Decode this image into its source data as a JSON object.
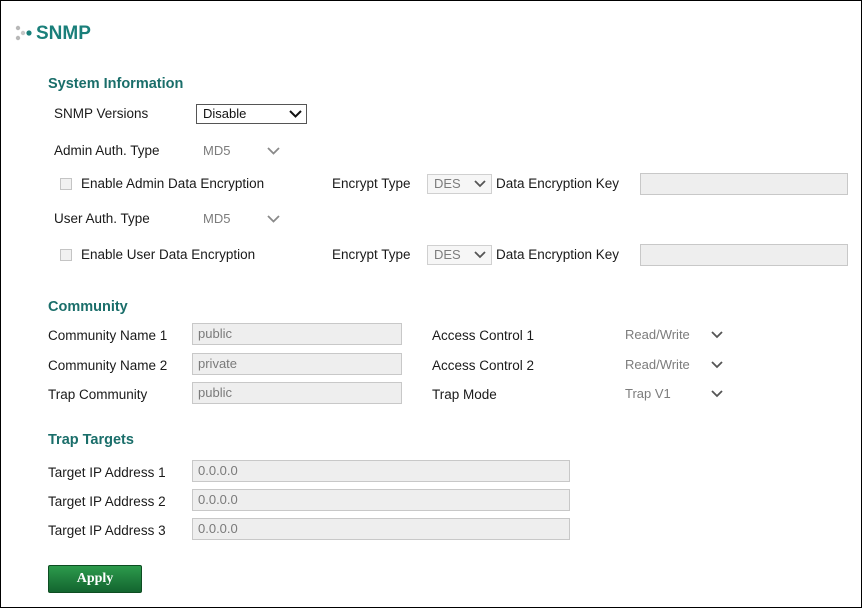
{
  "page": {
    "title": "SNMP",
    "icon": "dots-icon"
  },
  "system": {
    "heading": "System Information",
    "snmp_versions_label": "SNMP Versions",
    "snmp_versions_value": "Disable",
    "admin_auth_label": "Admin Auth. Type",
    "admin_auth_value": "MD5",
    "admin_encrypt_label": "Enable Admin Data Encryption",
    "admin_encrypt_checked": false,
    "encrypt_type_label": "Encrypt Type",
    "admin_encrypt_type_value": "DES",
    "data_key_label": "Data Encryption Key",
    "admin_data_key": "",
    "user_auth_label": "User Auth. Type",
    "user_auth_value": "MD5",
    "user_encrypt_label": "Enable User Data Encryption",
    "user_encrypt_checked": false,
    "user_encrypt_type_value": "DES",
    "user_data_key": ""
  },
  "community": {
    "heading": "Community",
    "name1_label": "Community Name 1",
    "name1_value": "public",
    "name2_label": "Community Name 2",
    "name2_value": "private",
    "trap_label": "Trap Community",
    "trap_value": "public",
    "access1_label": "Access Control 1",
    "access1_value": "Read/Write",
    "access2_label": "Access Control 2",
    "access2_value": "Read/Write",
    "trap_mode_label": "Trap Mode",
    "trap_mode_value": "Trap V1"
  },
  "targets": {
    "heading": "Trap Targets",
    "ip1_label": "Target IP Address 1",
    "ip1_value": "0.0.0.0",
    "ip2_label": "Target IP Address 2",
    "ip2_value": "0.0.0.0",
    "ip3_label": "Target IP Address 3",
    "ip3_value": "0.0.0.0"
  },
  "actions": {
    "apply_label": "Apply"
  },
  "colors": {
    "heading": "#1a6e6a",
    "title": "#1a7f7a",
    "apply": "#1e7a3a"
  }
}
